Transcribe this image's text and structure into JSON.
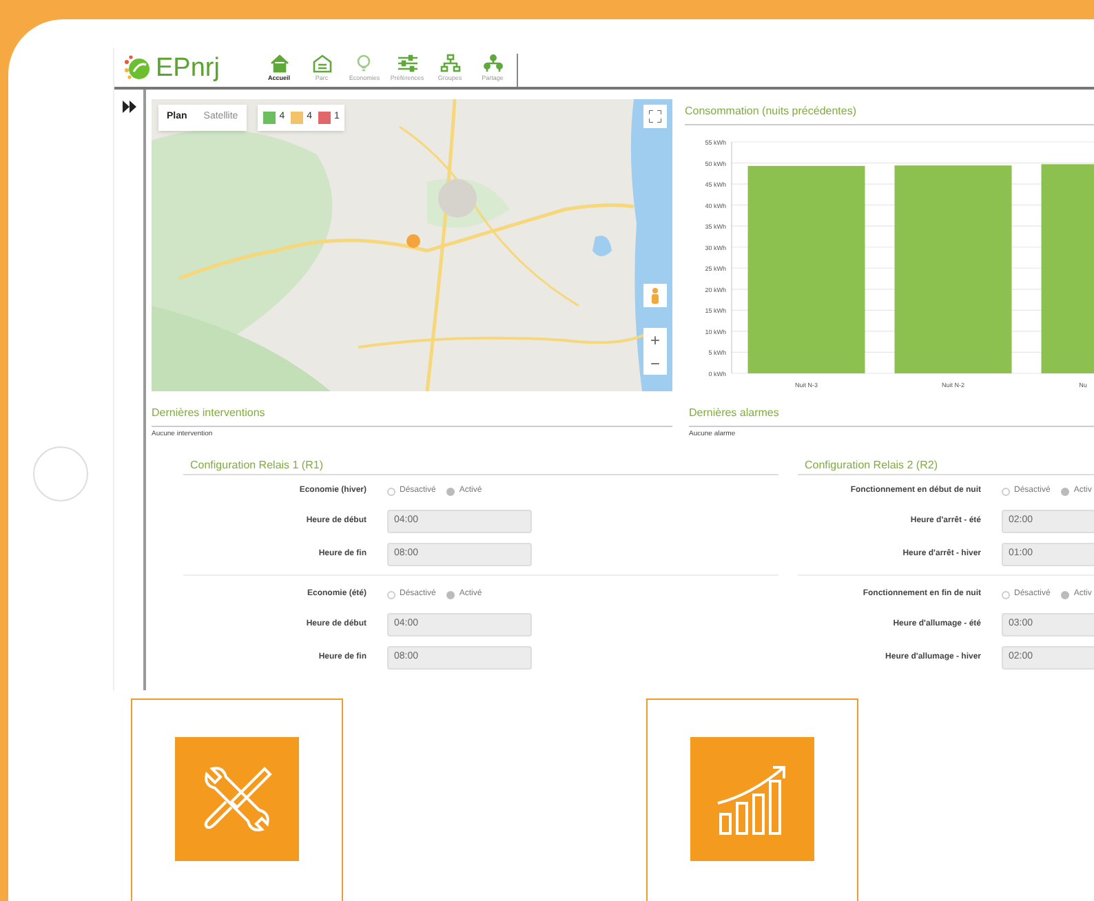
{
  "header": {
    "logo_text": "EPnrj",
    "nav": [
      {
        "label": "Accueil",
        "selected": true,
        "kind": "home"
      },
      {
        "label": "Parc",
        "selected": false,
        "kind": "park"
      },
      {
        "label": "Economies",
        "selected": false,
        "kind": "bulb"
      },
      {
        "label": "Préférences",
        "selected": false,
        "kind": "sliders"
      },
      {
        "label": "Groupes",
        "selected": false,
        "kind": "groups"
      },
      {
        "label": "Partage",
        "selected": false,
        "kind": "share"
      }
    ]
  },
  "map": {
    "view_buttons": [
      {
        "label": "Plan",
        "selected": true
      },
      {
        "label": "Satellite",
        "selected": false
      }
    ],
    "counters": [
      {
        "count": "4",
        "color": "#6cbf5f"
      },
      {
        "count": "4",
        "color": "#f2c36b"
      },
      {
        "count": "1",
        "color": "#e2676b"
      }
    ],
    "zoom_in": "+",
    "zoom_out": "−"
  },
  "consumption": {
    "title": "Consommation (nuits précédentes)",
    "chart_data": {
      "type": "bar",
      "categories": [
        "Nuit N-3",
        "Nuit N-2",
        "Nu"
      ],
      "values": [
        49.3,
        49.4,
        49.7
      ],
      "ylim": [
        0,
        55
      ],
      "yticks": [
        {
          "value": 0,
          "label": "0 kWh"
        },
        {
          "value": 5,
          "label": "5 kWh"
        },
        {
          "value": 10,
          "label": "10 kWh"
        },
        {
          "value": 15,
          "label": "15 kWh"
        },
        {
          "value": 20,
          "label": "20 kWh"
        },
        {
          "value": 25,
          "label": "25 kWh"
        },
        {
          "value": 30,
          "label": "30 kWh"
        },
        {
          "value": 35,
          "label": "35 kWh"
        },
        {
          "value": 40,
          "label": "40 kWh"
        },
        {
          "value": 45,
          "label": "45 kWh"
        },
        {
          "value": 50,
          "label": "50 kWh"
        },
        {
          "value": 55,
          "label": "55 kWh"
        }
      ],
      "grid": true
    }
  },
  "interventions": {
    "title": "Dernières interventions",
    "empty_text": "Aucune intervention"
  },
  "alarms": {
    "title": "Dernières alarmes",
    "empty_text": "Aucune alarme"
  },
  "relays": [
    {
      "title": "Configuration Relais 1 (R1)",
      "groups": [
        {
          "label": "Economie (hiver)",
          "options": [
            {
              "label": "Désactivé",
              "selected": false
            },
            {
              "label": "Activé",
              "selected": true
            }
          ],
          "fields": [
            {
              "label": "Heure de début",
              "value": "04:00"
            },
            {
              "label": "Heure de fin",
              "value": "08:00"
            }
          ]
        },
        {
          "label": "Economie (été)",
          "options": [
            {
              "label": "Désactivé",
              "selected": false
            },
            {
              "label": "Activé",
              "selected": true
            }
          ],
          "fields": [
            {
              "label": "Heure de début",
              "value": "04:00"
            },
            {
              "label": "Heure de fin",
              "value": "08:00"
            }
          ]
        }
      ]
    },
    {
      "title": "Configuration Relais 2 (R2)",
      "groups": [
        {
          "label": "Fonctionnement en début de nuit",
          "options": [
            {
              "label": "Désactivé",
              "selected": false
            },
            {
              "label": "Activ",
              "selected": true
            }
          ],
          "fields": [
            {
              "label": "Heure d'arrêt - été",
              "value": "02:00"
            },
            {
              "label": "Heure d'arrêt - hiver",
              "value": "01:00"
            }
          ]
        },
        {
          "label": "Fonctionnement en fin de nuit",
          "options": [
            {
              "label": "Désactivé",
              "selected": false
            },
            {
              "label": "Activ",
              "selected": true
            }
          ],
          "fields": [
            {
              "label": "Heure d'allumage - été",
              "value": "03:00"
            },
            {
              "label": "Heure d'allumage - hiver",
              "value": "02:00"
            }
          ]
        }
      ]
    }
  ],
  "feature_cards": [
    {
      "kind": "tools"
    },
    {
      "kind": "growth"
    }
  ]
}
